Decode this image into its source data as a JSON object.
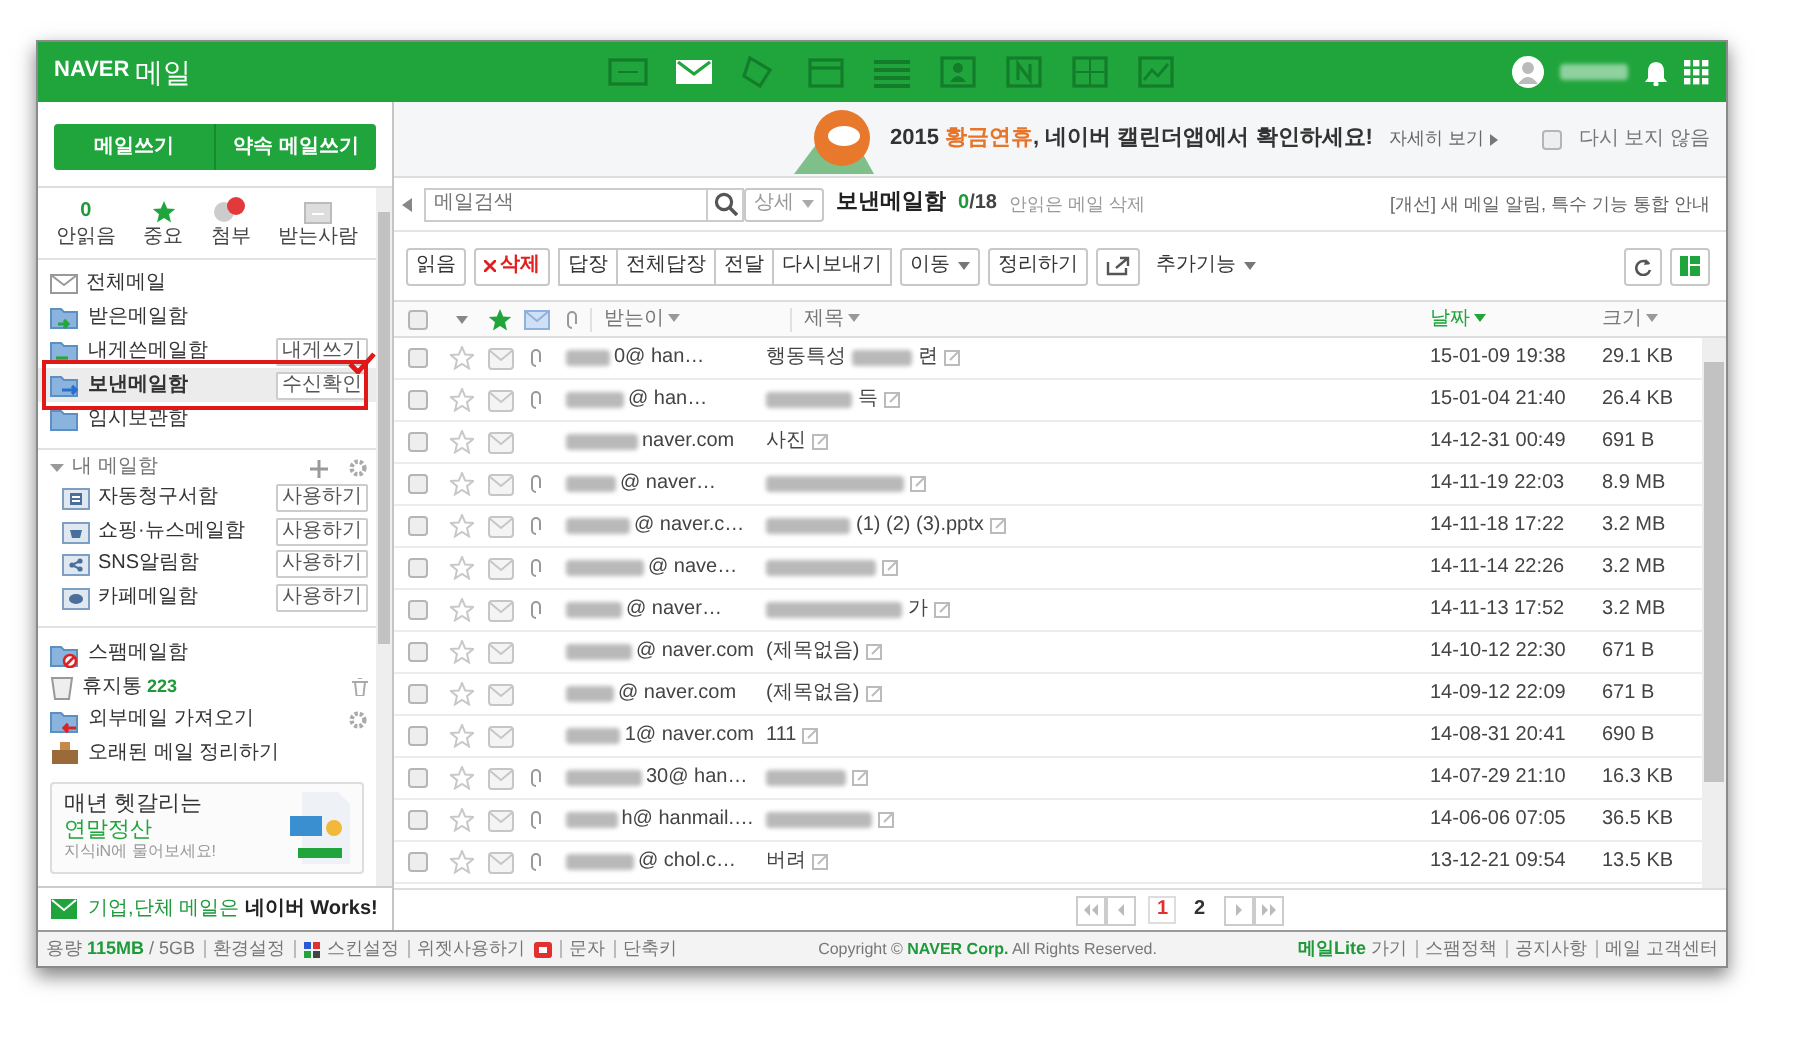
{
  "header": {
    "logo": "NAVER",
    "title": "메일",
    "apps": [
      {
        "kind": "memo",
        "selected": false
      },
      {
        "kind": "mail",
        "selected": true
      },
      {
        "kind": "tag",
        "selected": false
      },
      {
        "kind": "calendar",
        "selected": false
      },
      {
        "kind": "list",
        "selected": false
      },
      {
        "kind": "contacts",
        "selected": false
      },
      {
        "kind": "blog",
        "selected": false
      },
      {
        "kind": "note",
        "selected": false
      },
      {
        "kind": "chart",
        "selected": false
      }
    ]
  },
  "compose": [
    "메일쓰기",
    "약속 메일쓰기"
  ],
  "quick": [
    {
      "kind": "unread",
      "count": "0",
      "label": "안읽음"
    },
    {
      "kind": "star",
      "label": "중요"
    },
    {
      "kind": "attach",
      "label": "첨부"
    },
    {
      "kind": "people",
      "label": "받는사람"
    }
  ],
  "folders": [
    {
      "kind": "all",
      "label": "전체메일",
      "selected": false
    },
    {
      "kind": "inbox",
      "label": "받은메일함",
      "selected": false
    },
    {
      "kind": "self",
      "label": "내게쓴메일함",
      "action": "내게쓰기",
      "selected": false
    },
    {
      "kind": "sent",
      "label": "보낸메일함",
      "action": "수신확인",
      "selected": true
    },
    {
      "kind": "draft",
      "label": "임시보관함",
      "selected": false
    }
  ],
  "annotation": {
    "kind": "frame_with_check"
  },
  "my_folders": {
    "title": "내 메일함",
    "expanded": true,
    "items": [
      {
        "kind": "bill",
        "label": "자동청구서함",
        "action": "사용하기"
      },
      {
        "kind": "shop",
        "label": "쇼핑·뉴스메일함",
        "action": "사용하기"
      },
      {
        "kind": "sns",
        "label": "SNS알림함",
        "action": "사용하기"
      },
      {
        "kind": "cafe",
        "label": "카페메일함",
        "action": "사용하기"
      }
    ]
  },
  "system_folders": [
    {
      "kind": "spam",
      "label": "스팸메일함"
    },
    {
      "kind": "trash",
      "label": "휴지통",
      "count": "223"
    },
    {
      "kind": "import",
      "label": "외부메일 가져오기"
    },
    {
      "kind": "cleanup",
      "label": "오래된 메일 정리하기"
    }
  ],
  "ad": {
    "line1": "매년 헷갈리는",
    "line2": "연말정산",
    "line3": "지식iN에 물어보세요!"
  },
  "works_promo": "기업,단체 메일은 **네이버 Works!**",
  "banner": {
    "year": "2015",
    "highlight": "황금연휴",
    "text": ", 네이버 캘린더앱에서 확인하세요!",
    "more": "자세히 보기",
    "dismiss": {
      "label": "다시 보지 않음",
      "checked": false
    }
  },
  "search": {
    "placeholder": "메일검색",
    "detail": "상세"
  },
  "mailbox": {
    "name": "보낸메일함",
    "unread": "0",
    "total": "/18",
    "action": "안읽은 메일 삭제"
  },
  "notice": "[개선] 새 메일 알림, 특수 기능 통합 안내",
  "toolbar": [
    {
      "kind": "button",
      "label": "읽음"
    },
    {
      "kind": "delete",
      "label": "삭제"
    },
    {
      "kind": "group",
      "items": [
        "답장",
        "전체답장",
        "전달",
        "다시보내기"
      ]
    },
    {
      "kind": "dropdown",
      "label": "이동"
    },
    {
      "kind": "button",
      "label": "정리하기"
    },
    {
      "kind": "export"
    },
    {
      "kind": "menu",
      "label": "추가기능"
    }
  ],
  "table": {
    "select_all_checked": false,
    "columns": [
      {
        "label": "받는이",
        "selected": false
      },
      {
        "label": "제목",
        "selected": false
      },
      {
        "label": "날짜",
        "selected": true
      },
      {
        "label": "크기",
        "selected": false
      }
    ],
    "rows": [
      {
        "checked": false,
        "starred": false,
        "attachment": true,
        "recipient": "0@ han…",
        "subject_pre": "행동특성",
        "subject_blurred": true,
        "subject": "련",
        "date": "15-01-09 19:38",
        "size": "29.1 KB"
      },
      {
        "checked": false,
        "starred": false,
        "attachment": true,
        "recipient": "@ han…",
        "subject_blurred": true,
        "subject": "득",
        "date": "15-01-04 21:40",
        "size": "26.4 KB"
      },
      {
        "checked": false,
        "starred": false,
        "attachment": false,
        "recipient": "naver.com",
        "subject_blurred": false,
        "subject": "사진",
        "date": "14-12-31 00:49",
        "size": "691 B"
      },
      {
        "checked": false,
        "starred": false,
        "attachment": true,
        "recipient": "@ naver…",
        "subject_blurred": true,
        "date": "14-11-19 22:03",
        "size": "8.9 MB"
      },
      {
        "checked": false,
        "starred": false,
        "attachment": true,
        "recipient": "@ naver.c…",
        "subject_blurred": true,
        "subject": "(1) (2) (3).pptx",
        "date": "14-11-18 17:22",
        "size": "3.2 MB"
      },
      {
        "checked": false,
        "starred": false,
        "attachment": true,
        "recipient": "@ nave…",
        "subject_blurred": true,
        "date": "14-11-14 22:26",
        "size": "3.2 MB"
      },
      {
        "checked": false,
        "starred": false,
        "attachment": true,
        "recipient": "@ naver…",
        "subject_blurred": true,
        "subject": "가",
        "date": "14-11-13 17:52",
        "size": "3.2 MB"
      },
      {
        "checked": false,
        "starred": false,
        "attachment": false,
        "recipient": "@ naver.com",
        "subject_blurred": false,
        "subject": "(제목없음)",
        "date": "14-10-12 22:30",
        "size": "671 B"
      },
      {
        "checked": false,
        "starred": false,
        "attachment": false,
        "recipient": "@ naver.com",
        "subject_blurred": false,
        "subject": "(제목없음)",
        "date": "14-09-12 22:09",
        "size": "671 B"
      },
      {
        "checked": false,
        "starred": false,
        "attachment": false,
        "recipient": "1@ naver.com",
        "subject_blurred": false,
        "subject": "111",
        "date": "14-08-31 20:41",
        "size": "690 B"
      },
      {
        "checked": false,
        "starred": false,
        "attachment": true,
        "recipient": "30@ han…",
        "subject_blurred": true,
        "date": "14-07-29 21:10",
        "size": "16.3 KB"
      },
      {
        "checked": false,
        "starred": false,
        "attachment": true,
        "recipient": "h@ hanmail.…",
        "subject_blurred": true,
        "date": "14-06-06 07:05",
        "size": "36.5 KB"
      },
      {
        "checked": false,
        "starred": false,
        "attachment": true,
        "recipient": "@ chol.c…",
        "subject_blurred": false,
        "subject": "버려",
        "date": "13-12-21 09:54",
        "size": "13.5 KB"
      }
    ]
  },
  "pagination": [
    {
      "label": "1",
      "selected": true
    },
    {
      "label": "2",
      "selected": false
    }
  ],
  "footer": {
    "quota_label": "용량",
    "quota_used": "115MB",
    "quota_total": "/ 5GB",
    "links": [
      {
        "kind": "text",
        "label": "환경설정"
      },
      {
        "kind": "skin",
        "label": "스킨설정"
      },
      {
        "kind": "widget",
        "label": "위젯사용하기"
      },
      {
        "kind": "text",
        "label": "문자"
      },
      {
        "kind": "text",
        "label": "단축키"
      }
    ],
    "copyright_pre": "Copyright ©",
    "copyright_brand": "NAVER Corp.",
    "copyright_post": "All Rights Reserved.",
    "right_links": [
      {
        "kind": "lite",
        "brand": "메일Lite",
        "label": "가기"
      },
      {
        "kind": "text",
        "label": "스팸정책"
      },
      {
        "kind": "text",
        "label": "공지사항"
      },
      {
        "kind": "text",
        "label": "메일 고객센터"
      }
    ]
  }
}
